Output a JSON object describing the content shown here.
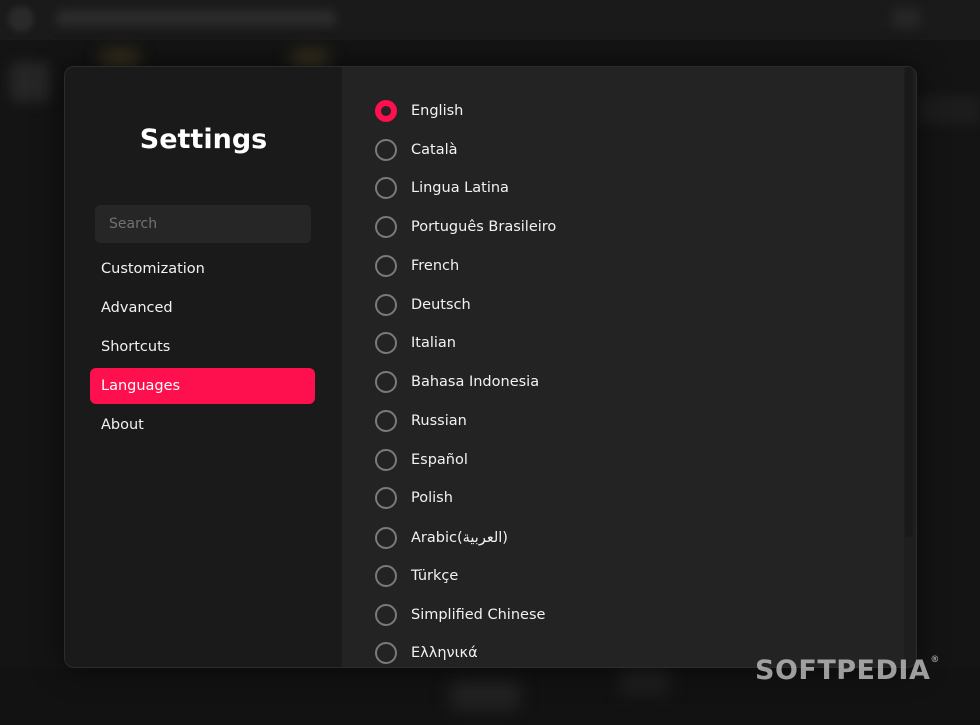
{
  "settings": {
    "title": "Settings",
    "search_placeholder": "Search",
    "nav": [
      {
        "label": "Customization",
        "active": false
      },
      {
        "label": "Advanced",
        "active": false
      },
      {
        "label": "Shortcuts",
        "active": false
      },
      {
        "label": "Languages",
        "active": true
      },
      {
        "label": "About",
        "active": false
      }
    ]
  },
  "languages": {
    "selected": "English",
    "items": [
      "English",
      "Català",
      "Lingua Latina",
      "Português Brasileiro",
      "French",
      "Deutsch",
      "Italian",
      "Bahasa Indonesia",
      "Russian",
      "Español",
      "Polish",
      "Arabic(العربية)",
      "Türkçe",
      "Simplified Chinese",
      "Ελληνικά"
    ]
  },
  "watermark": "SOFTPEDIA",
  "colors": {
    "accent": "#fe0f4e",
    "dialog_bg": "#1a1a1a",
    "content_bg": "#232323"
  }
}
